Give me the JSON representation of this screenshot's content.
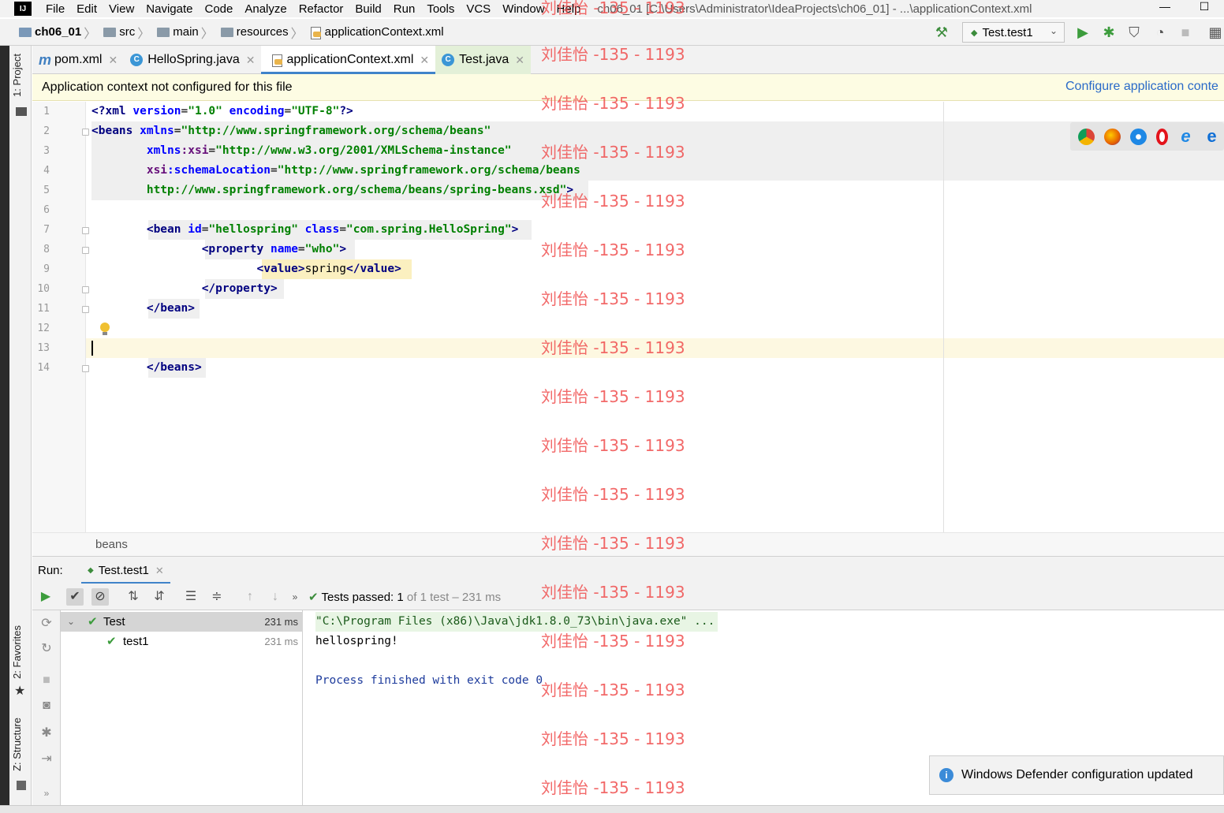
{
  "menubar": {
    "items": [
      "File",
      "Edit",
      "View",
      "Navigate",
      "Code",
      "Analyze",
      "Refactor",
      "Build",
      "Run",
      "Tools",
      "VCS",
      "Window",
      "Help"
    ],
    "window_title": "ch06_01 [C:\\Users\\Administrator\\IdeaProjects\\ch06_01] - ...\\applicationContext.xml",
    "minimize": "—",
    "maximize": "☐"
  },
  "navbar": {
    "crumbs": [
      "ch06_01",
      "src",
      "main",
      "resources",
      "applicationContext.xml"
    ],
    "run_config": "Test.test1"
  },
  "sidebar": {
    "project": "1: Project",
    "favorites": "2: Favorites",
    "structure": "Z: Structure"
  },
  "tabs": [
    {
      "label": "pom.xml",
      "icon": "maven-icon"
    },
    {
      "label": "HelloSpring.java",
      "icon": "class-icon"
    },
    {
      "label": "applicationContext.xml",
      "icon": "xml-icon"
    },
    {
      "label": "Test.java",
      "icon": "test-class-icon"
    }
  ],
  "notification": {
    "message": "Application context not configured for this file",
    "link": "Configure application conte"
  },
  "editor": {
    "line_numbers": [
      "1",
      "2",
      "3",
      "4",
      "5",
      "6",
      "7",
      "8",
      "9",
      "10",
      "11",
      "12",
      "13",
      "14"
    ],
    "breadcrumb": "beans"
  },
  "run": {
    "label": "Run:",
    "tab": "Test.test1",
    "status_prefix": "Tests passed:",
    "status_count": "1",
    "status_suffix": "of 1 test – 231 ms",
    "tree": [
      {
        "name": "Test",
        "time": "231 ms"
      },
      {
        "name": "test1",
        "time": "231 ms"
      }
    ],
    "console": [
      "\"C:\\Program Files (x86)\\Java\\jdk1.8.0_73\\bin\\java.exe\" ...",
      "hellospring!",
      "",
      "Process finished with exit code 0"
    ]
  },
  "watermark": "刘佳怡 -135 - 1193",
  "balloon": {
    "message": "Windows Defender configuration updated"
  },
  "colors": {
    "accent": "#4083c9",
    "notification_bg": "#fdfce3",
    "tag": "#000080",
    "string": "#008000",
    "pass_green": "#3c9c3c",
    "watermark": "#f05050"
  }
}
